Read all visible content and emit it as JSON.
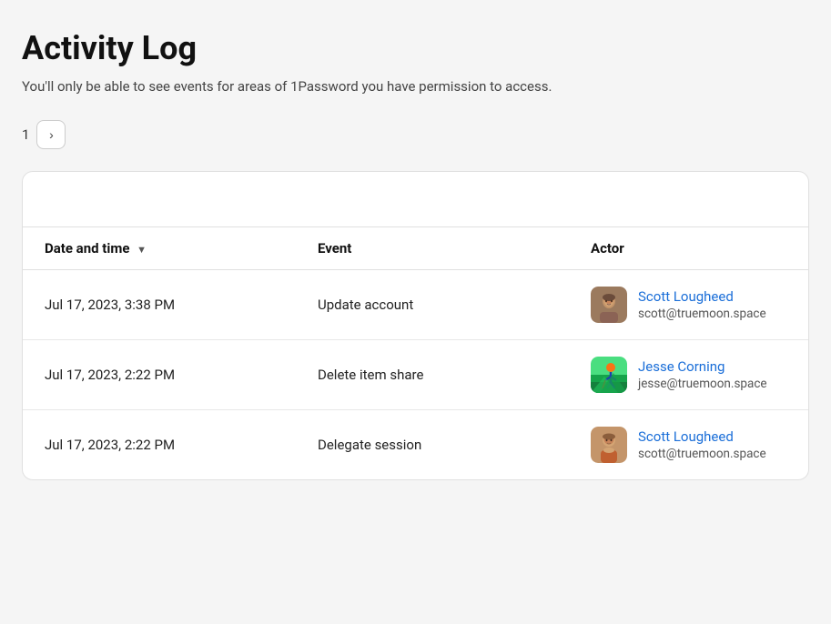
{
  "page": {
    "title": "Activity Log",
    "subtitle": "You'll only be able to see events for areas of 1Password you have permission to access."
  },
  "pagination": {
    "current_page": "1",
    "next_button_label": "›"
  },
  "table": {
    "columns": [
      {
        "key": "date",
        "label": "Date and time",
        "sortable": true
      },
      {
        "key": "event",
        "label": "Event",
        "sortable": false
      },
      {
        "key": "actor",
        "label": "Actor",
        "sortable": false
      }
    ],
    "rows": [
      {
        "date": "Jul 17, 2023, 3:38 PM",
        "event": "Update account",
        "actor_name": "Scott Lougheed",
        "actor_email": "scott@truemoon.space",
        "actor_avatar_type": "scott-1"
      },
      {
        "date": "Jul 17, 2023, 2:22 PM",
        "event": "Delete item share",
        "actor_name": "Jesse Corning",
        "actor_email": "jesse@truemoon.space",
        "actor_avatar_type": "jesse"
      },
      {
        "date": "Jul 17, 2023, 2:22 PM",
        "event": "Delegate session",
        "actor_name": "Scott Lougheed",
        "actor_email": "scott@truemoon.space",
        "actor_avatar_type": "scott-2"
      }
    ]
  },
  "colors": {
    "accent": "#1a6ed8",
    "border": "#e0e0e0",
    "text_primary": "#111",
    "text_secondary": "#555"
  }
}
